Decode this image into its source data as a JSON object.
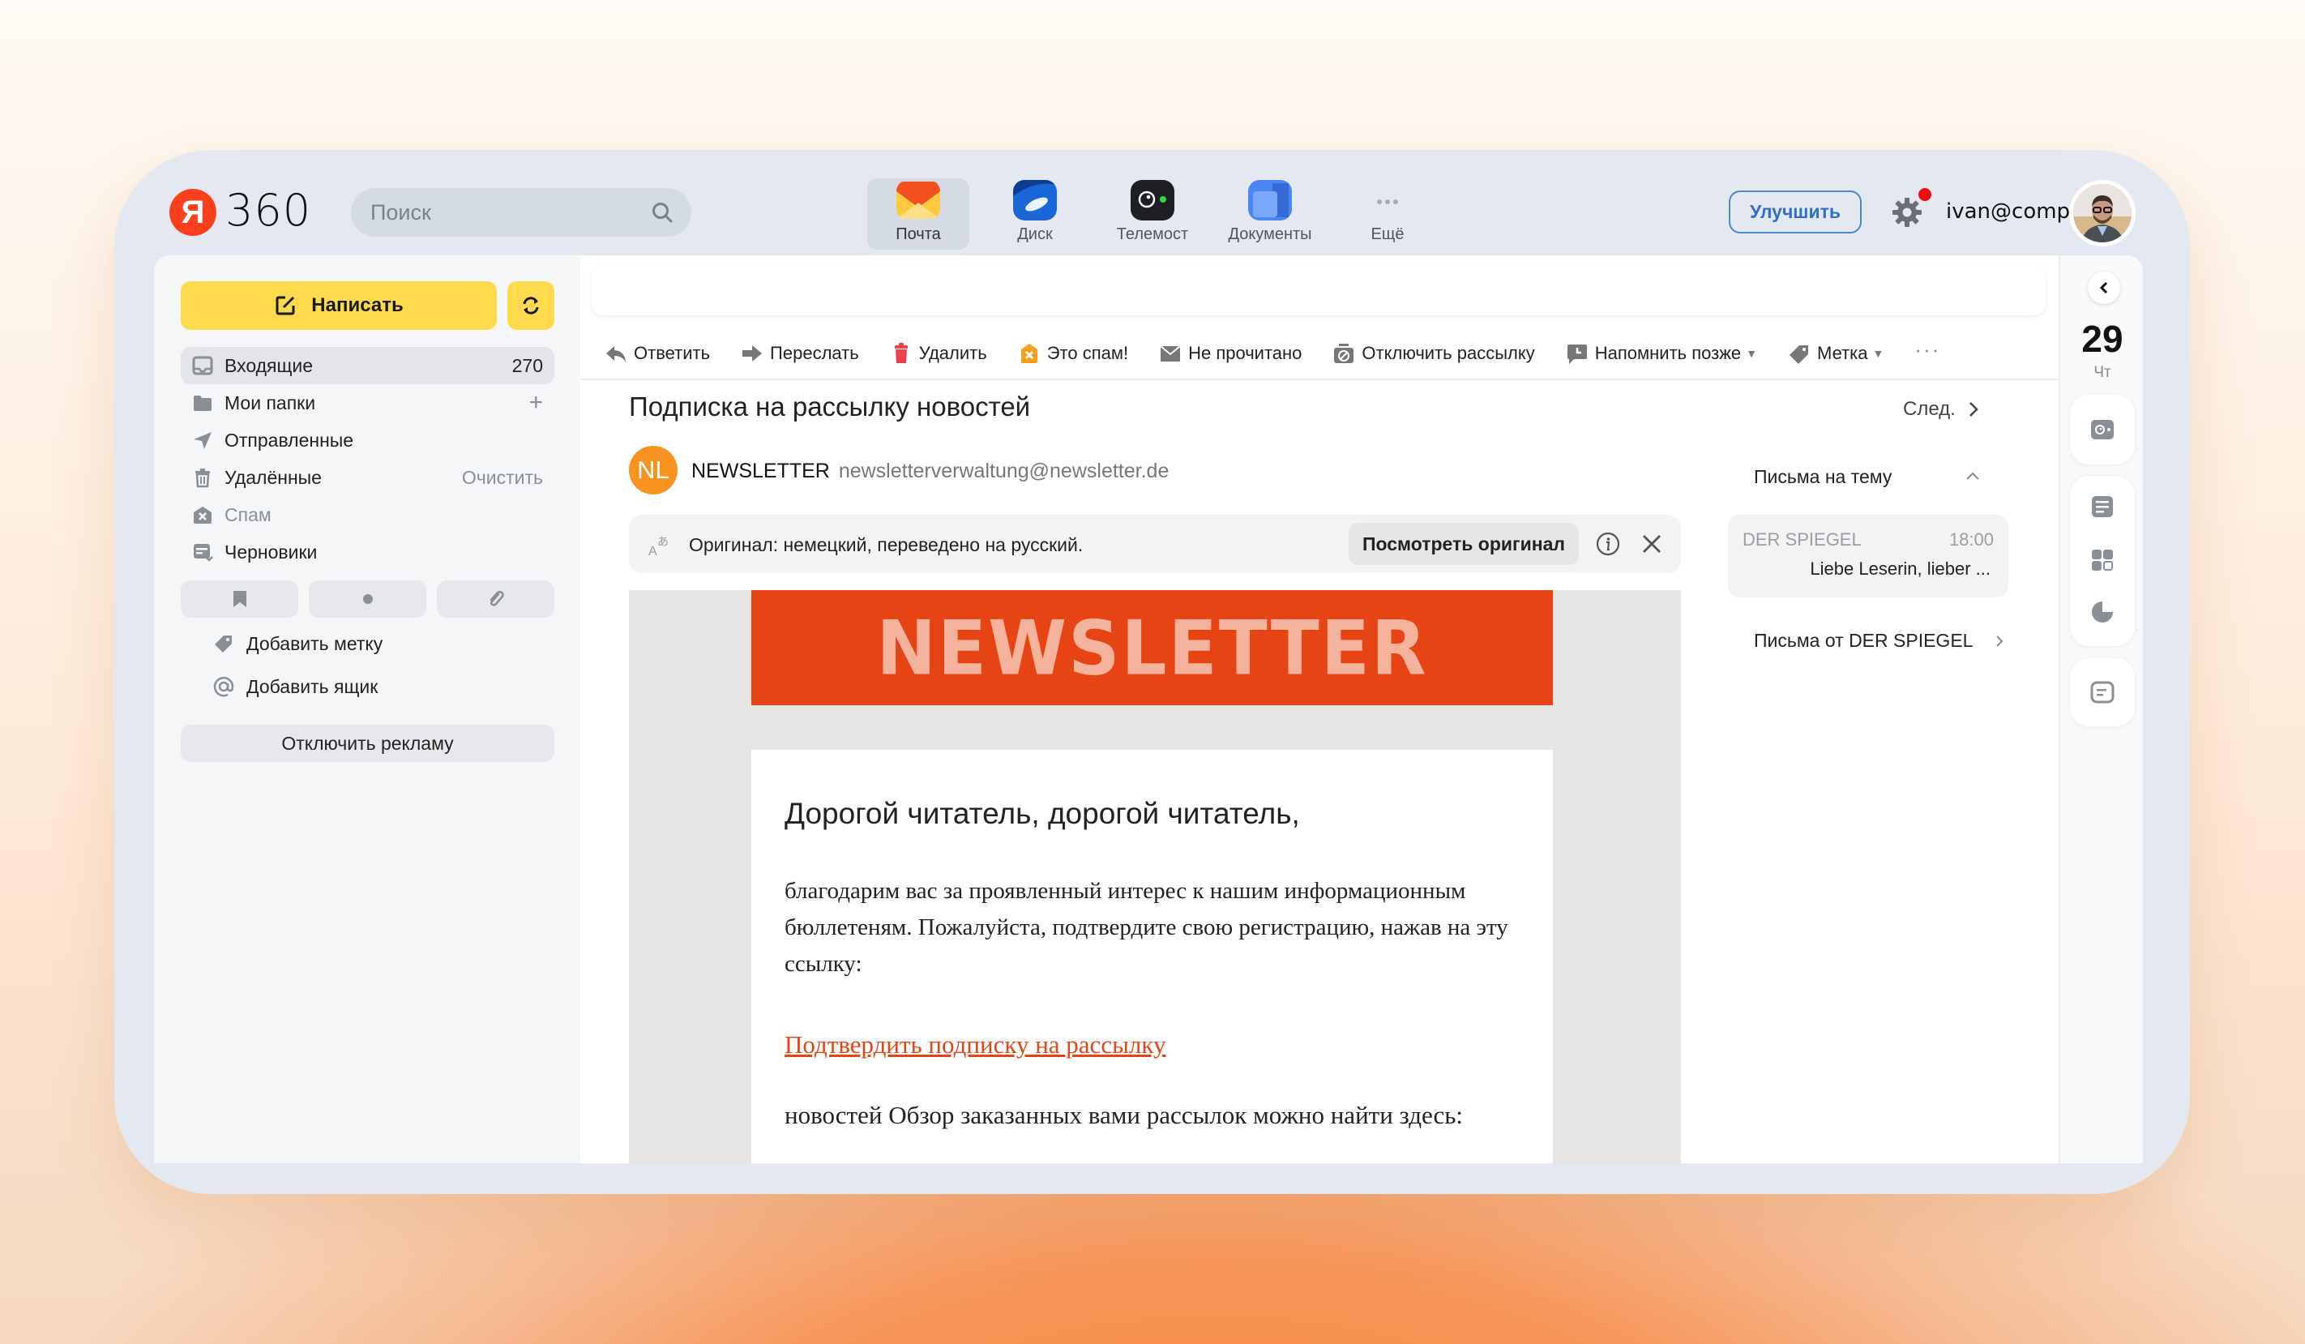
{
  "header": {
    "logo_letter": "Я",
    "logo_text": "360",
    "search_placeholder": "Поиск",
    "apps": [
      {
        "label": "Почта",
        "active": true
      },
      {
        "label": "Диск",
        "active": false
      },
      {
        "label": "Телемост",
        "active": false
      },
      {
        "label": "Документы",
        "active": false
      },
      {
        "label": "Ещё",
        "active": false
      }
    ],
    "upgrade_label": "Улучшить",
    "user_email": "ivan@comp...",
    "settings_notification": true
  },
  "sidebar": {
    "compose_label": "Написать",
    "folders": [
      {
        "label": "Входящие",
        "right": "270",
        "icon": "inbox-icon",
        "active": true
      },
      {
        "label": "Мои папки",
        "right": "+",
        "icon": "folder-icon"
      },
      {
        "label": "Отправленные",
        "right": "",
        "icon": "sent-icon"
      },
      {
        "label": "Удалённые",
        "right": "Очистить",
        "icon": "trash-icon"
      },
      {
        "label": "Спам",
        "right": "",
        "icon": "spam-icon"
      },
      {
        "label": "Черновики",
        "right": "",
        "icon": "drafts-icon"
      }
    ],
    "filters": [
      "bookmark-icon",
      "unread-dot-icon",
      "attachment-icon"
    ],
    "add_label": "Добавить метку",
    "add_mailbox": "Добавить ящик",
    "disable_ads": "Отключить рекламу"
  },
  "toolbar": {
    "items": [
      {
        "label": "Ответить",
        "icon": "reply-icon"
      },
      {
        "label": "Переслать",
        "icon": "forward-icon"
      },
      {
        "label": "Удалить",
        "icon": "delete-icon"
      },
      {
        "label": "Это спам!",
        "icon": "spam-mark-icon"
      },
      {
        "label": "Не прочитано",
        "icon": "unread-icon"
      },
      {
        "label": "Отключить рассылку",
        "icon": "unsubscribe-icon"
      },
      {
        "label": "Напомнить позже",
        "icon": "remind-icon",
        "dropdown": true
      },
      {
        "label": "Метка",
        "icon": "label-icon",
        "dropdown": true
      }
    ],
    "more": "···"
  },
  "message": {
    "subject": "Подписка на рассылку новостей",
    "next_label": "След.",
    "sender_initials": "NL",
    "sender_name": "NEWSLETTER",
    "sender_email": "newsletterverwaltung@newsletter.de",
    "translate_text": "Оригинал: немецкий, переведено на русский.",
    "view_original": "Посмотреть оригинал",
    "banner_text": "NEWSLETTER",
    "greeting": "Дорогой читатель, дорогой читатель,",
    "paragraph1": "благодарим вас за проявленный интерес к нашим информационным бюллетеням. Пожалуйста, подтвердите свою регистрацию, нажав на эту ссылку:",
    "confirm_link": "Подтвердить подписку на рассылку",
    "paragraph2": "новостей Обзор заказанных вами рассылок можно найти здесь:"
  },
  "related": {
    "title": "Письма на тему",
    "items": [
      {
        "from": "DER SPIEGEL",
        "time": "18:00",
        "snippet": "Liebe Leserin, lieber ..."
      }
    ],
    "from_link": "Письма от DER SPIEGEL"
  },
  "rail": {
    "day": "29",
    "weekday": "Чт"
  },
  "colors": {
    "accent_yellow": "#fedb4d",
    "brand_red": "#fc3f1d",
    "newsletter_orange": "#e64415",
    "upgrade_blue": "#2f6fc9"
  }
}
